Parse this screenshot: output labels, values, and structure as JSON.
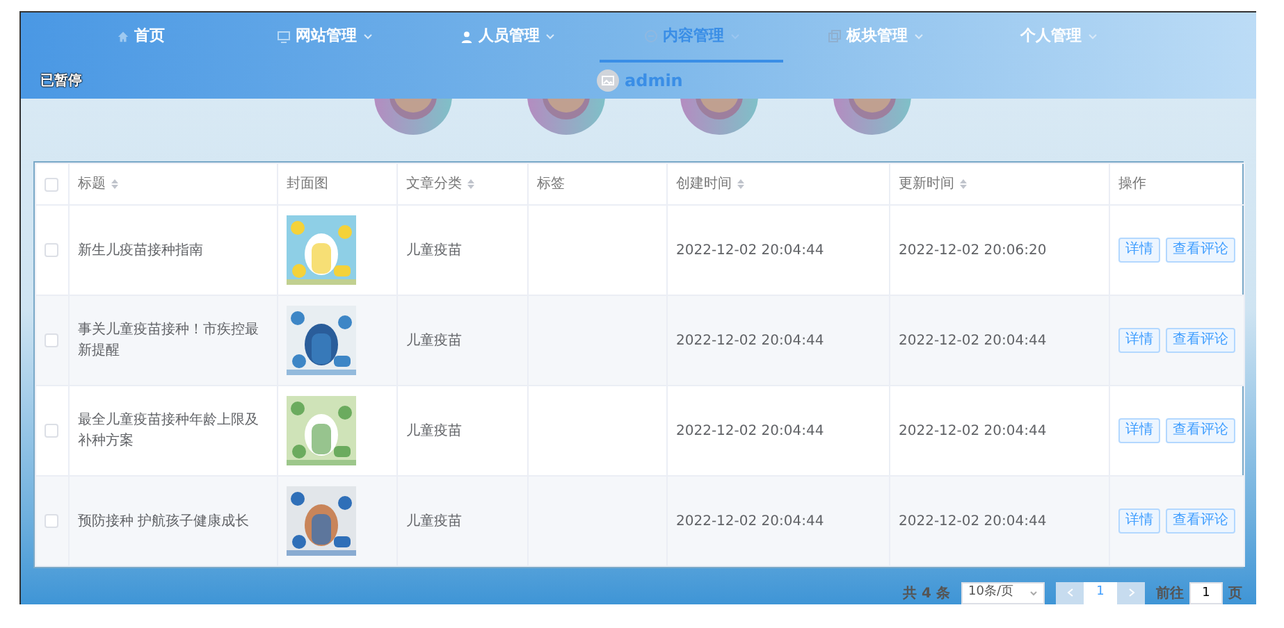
{
  "nav": {
    "items": [
      {
        "label": "首页",
        "selected": false,
        "dropdown": false
      },
      {
        "label": "网站管理",
        "selected": false,
        "dropdown": true
      },
      {
        "label": "人员管理",
        "selected": false,
        "dropdown": true
      },
      {
        "label": "内容管理",
        "selected": true,
        "dropdown": true
      },
      {
        "label": "板块管理",
        "selected": false,
        "dropdown": true
      },
      {
        "label": "个人管理",
        "selected": false,
        "dropdown": true
      }
    ],
    "status": "已暂停",
    "user": "admin"
  },
  "table": {
    "columns": [
      {
        "label": "标题",
        "sortable": true
      },
      {
        "label": "封面图",
        "sortable": false
      },
      {
        "label": "文章分类",
        "sortable": true
      },
      {
        "label": "标签",
        "sortable": false
      },
      {
        "label": "创建时间",
        "sortable": true
      },
      {
        "label": "更新时间",
        "sortable": true
      },
      {
        "label": "操作",
        "sortable": false
      }
    ],
    "header_checked": false,
    "rows": [
      {
        "checked": false,
        "title": "新生儿疫苗接种指南",
        "category": "儿童疫苗",
        "created": "2022-12-02 20:04:44",
        "updated": "2022-12-02 20:06:20",
        "actions": [
          "详情",
          "查看评论"
        ]
      },
      {
        "checked": false,
        "title": "事关儿童疫苗接种！市疾控最新提醒",
        "category": "儿童疫苗",
        "created": "2022-12-02 20:04:44",
        "updated": "2022-12-02 20:04:44",
        "actions": [
          "详情",
          "查看评论"
        ]
      },
      {
        "checked": false,
        "title": "最全儿童疫苗接种年龄上限及补种方案",
        "category": "儿童疫苗",
        "created": "2022-12-02 20:04:44",
        "updated": "2022-12-02 20:04:44",
        "actions": [
          "详情",
          "查看评论"
        ]
      },
      {
        "checked": false,
        "title": "预防接种 护航孩子健康成长",
        "category": "儿童疫苗",
        "created": "2022-12-02 20:04:44",
        "updated": "2022-12-02 20:04:44",
        "actions": [
          "详情",
          "查看评论"
        ]
      }
    ]
  },
  "pagination": {
    "total": "共 4 条",
    "page_size": "10条/页",
    "pages": [
      {
        "label": "1",
        "selected": true
      }
    ],
    "goto_label": "前往",
    "goto_value": "1",
    "goto_suffix": "页"
  }
}
